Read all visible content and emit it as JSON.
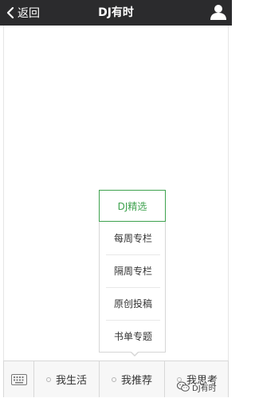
{
  "header": {
    "back_label": "返回",
    "title": "DJ有时"
  },
  "popup_menu": {
    "items": [
      {
        "label": "DJ精选",
        "selected": true
      },
      {
        "label": "每周专栏",
        "selected": false
      },
      {
        "label": "隔周专栏",
        "selected": false
      },
      {
        "label": "原创投稿",
        "selected": false
      },
      {
        "label": "书单专题",
        "selected": false
      }
    ]
  },
  "bottom_menu": {
    "tabs": [
      {
        "label": "我生活"
      },
      {
        "label": "我推荐"
      },
      {
        "label": "我思考"
      }
    ]
  },
  "watermark": {
    "text": "DJ有时"
  },
  "colors": {
    "header_bg": "#2b2b2d",
    "accent_green": "#3ea24e",
    "bottom_bg": "#f7f7f7"
  },
  "icons": {
    "back": "chevron-left-icon",
    "profile": "person-icon",
    "keyboard": "keyboard-icon",
    "watermark": "wechat-icon"
  }
}
